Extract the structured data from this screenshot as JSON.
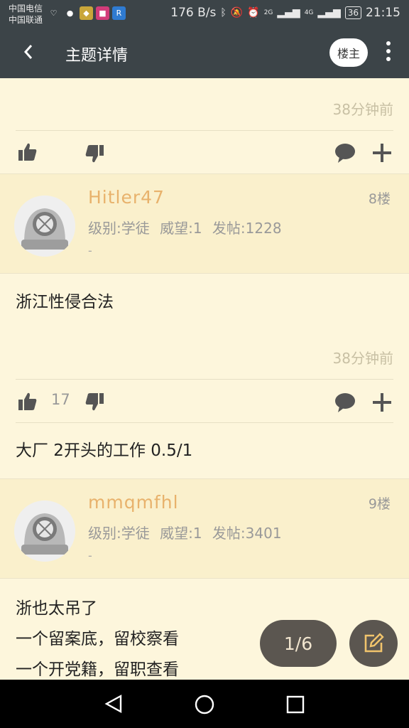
{
  "status_bar": {
    "carrier1": "中国电信",
    "carrier2": "中国联通",
    "speed": "176 B/s",
    "network1": "2G",
    "network2": "4G",
    "battery": "36",
    "time": "21:15"
  },
  "app_bar": {
    "title": "主题详情",
    "owner_button": "楼主"
  },
  "post_top": {
    "time": "38分钟前"
  },
  "post8": {
    "username": "Hitler47",
    "floor": "8楼",
    "meta": "级别:学徒 威望:1 发帖:1228",
    "dash": "-",
    "content": "浙江性侵合法",
    "time": "38分钟前",
    "likes": "17",
    "reply_preview": "大厂 2开头的工作 0.5/1"
  },
  "post9": {
    "username": "mmqmfhl",
    "floor": "9楼",
    "meta": "级别:学徒 威望:1 发帖:3401",
    "dash": "-",
    "lines": [
      "浙也太吊了",
      "一个留案底，留校察看",
      "一个开党籍，留职查看"
    ]
  },
  "fab": {
    "page": "1/6"
  },
  "icons": {
    "back": "chevron-left-icon",
    "more": "more-vert-icon",
    "like": "thumb-up-icon",
    "dislike": "thumb-down-icon",
    "comment": "comment-icon",
    "add": "plus-icon",
    "edit": "edit-icon"
  },
  "colors": {
    "bar": "#3c4448",
    "background": "#fdf6dc",
    "header": "#faf0cc",
    "username": "#e8b26c",
    "fab": "#5b5650"
  }
}
